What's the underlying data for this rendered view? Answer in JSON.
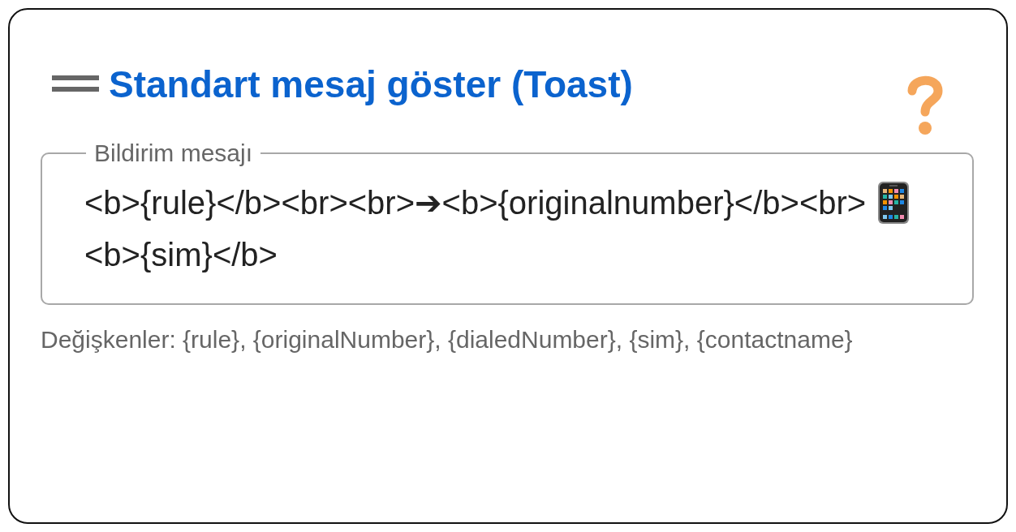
{
  "card": {
    "title": "Standart mesaj göster (Toast)",
    "field": {
      "label": "Bildirim mesajı",
      "segments": [
        {
          "kind": "text",
          "text": "<b>{rule}</b><br><br>➔"
        },
        {
          "kind": "text",
          "text": "<b>{originalnumber}</b><br>"
        },
        {
          "kind": "phone"
        },
        {
          "kind": "text",
          "text": "<b>{sim}"
        },
        {
          "kind": "text",
          "text": "</b>"
        }
      ]
    },
    "helper": "Değişkenler: {rule}, {originalNumber}, {dialedNumber}, {sim}, {contactname}"
  }
}
